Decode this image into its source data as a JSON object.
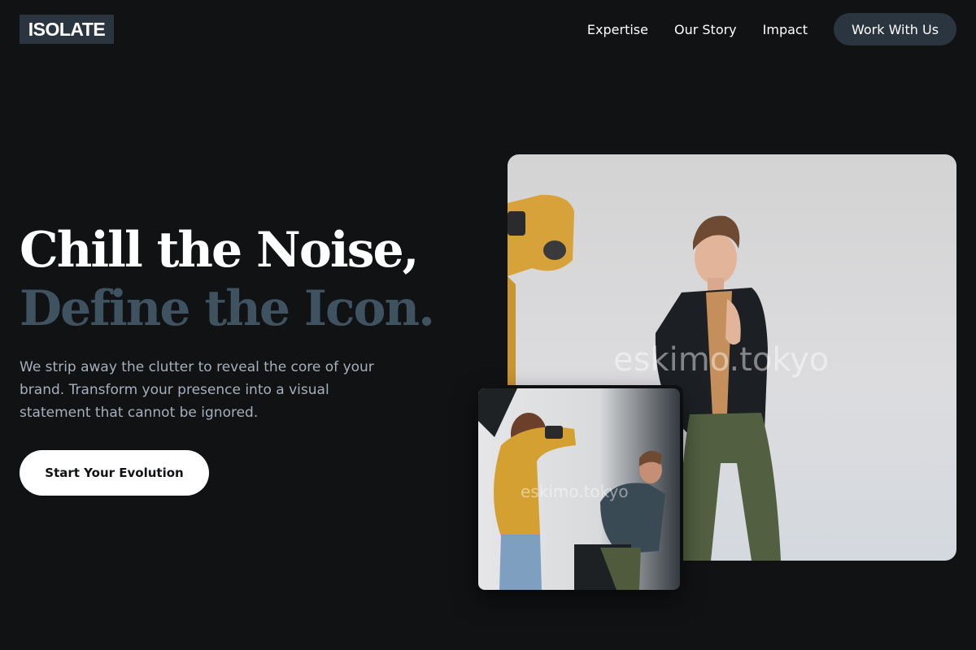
{
  "header": {
    "logo": "ISOLATE",
    "nav": [
      "Expertise",
      "Our Story",
      "Impact"
    ],
    "cta": "Work With Us"
  },
  "hero": {
    "headline_line1": "Chill the Noise,",
    "headline_line2": "Define the Icon.",
    "subtext": "We strip away the clutter to reveal the core of your brand. Transform your presence into a visual statement that cannot be ignored.",
    "cta": "Start Your Evolution"
  },
  "images": {
    "watermark": "eskimo.tokyo"
  },
  "colors": {
    "background": "#111214",
    "accent_dark": "#2a3540",
    "headline_secondary": "#3f5260",
    "body_text": "#a6b0bb"
  }
}
